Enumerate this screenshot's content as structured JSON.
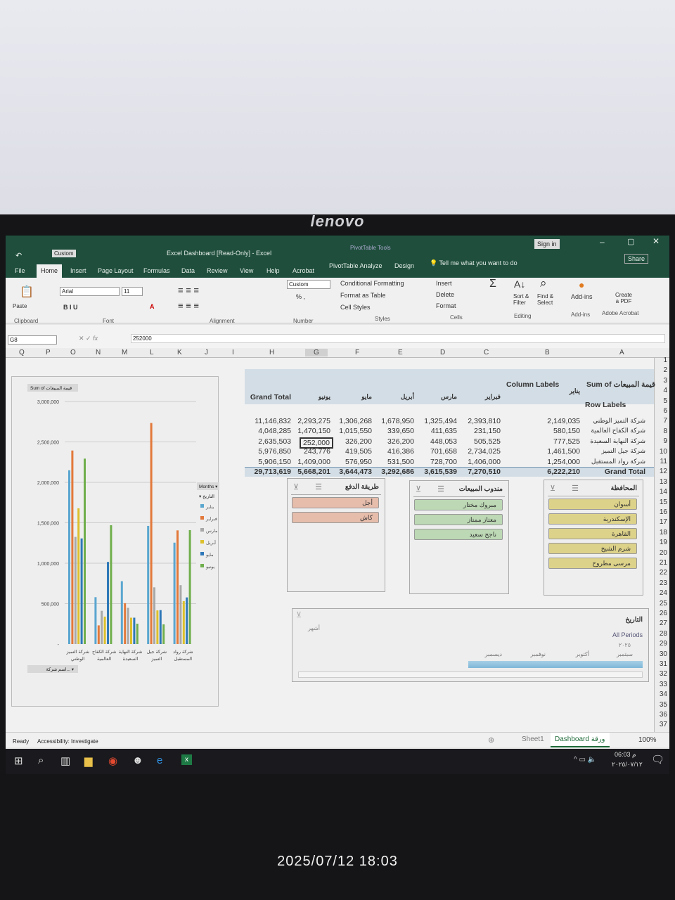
{
  "monitor": {
    "brand": "lenovo"
  },
  "photo_timestamp": "2025/07/12  18:03",
  "title": {
    "window": "Excel Dashboard  [Read-Only]  -  Excel",
    "contextual": "PivotTable Tools",
    "quick_style": "Custom",
    "sign_in": "Sign in",
    "share": "Share",
    "tell_me": "Tell me what you want to do"
  },
  "tabs": [
    "File",
    "Home",
    "Insert",
    "Page Layout",
    "Formulas",
    "Data",
    "Review",
    "View",
    "Help",
    "Acrobat",
    "PivotTable Analyze",
    "Design"
  ],
  "ribbon": {
    "paste": "Paste",
    "font_name": "Arial",
    "font_size": "11",
    "number_format": "Custom",
    "conditional": "Conditional Formatting",
    "format_table": "Format as Table",
    "cell_styles": "Cell Styles",
    "insert": "Insert",
    "delete": "Delete",
    "format": "Format",
    "sort": "Sort & Filter",
    "find": "Find & Select",
    "addins": "Add-ins",
    "create_pdf": "Create a PDF",
    "groups": {
      "clipboard": "Clipboard",
      "font": "Font",
      "alignment": "Alignment",
      "number": "Number",
      "styles": "Styles",
      "cells": "Cells",
      "editing": "Editing",
      "addins": "Add-ins",
      "acrobat": "Adobe Acrobat"
    }
  },
  "formula": {
    "name_box": "G8",
    "value": "252000"
  },
  "columns": [
    "A",
    "B",
    "C",
    "D",
    "E",
    "F",
    "G",
    "H",
    "I",
    "J",
    "K",
    "L",
    "M",
    "N",
    "O",
    "P",
    "Q"
  ],
  "pivot": {
    "corner": "Sum of قيمة المبيعات",
    "column_labels": "Column Labels",
    "row_labels": "Row Labels",
    "grand_total": "Grand Total",
    "months": [
      "يناير",
      "فبراير",
      "مارس",
      "أبريل",
      "مايو",
      "يونيو"
    ],
    "rows": [
      {
        "name": "شركة التميز الوطني",
        "values": [
          "2,149,035",
          "2,393,810",
          "1,325,494",
          "1,678,950",
          "1,306,268",
          "2,293,275",
          "11,146,832"
        ]
      },
      {
        "name": "شركة الكفاح العالمية",
        "values": [
          "580,150",
          "231,150",
          "411,635",
          "339,650",
          "1,015,550",
          "1,470,150",
          "4,048,285"
        ]
      },
      {
        "name": "شركة النهاية السعيدة",
        "values": [
          "777,525",
          "505,525",
          "448,053",
          "326,200",
          "326,200",
          "252,000",
          "2,635,503"
        ]
      },
      {
        "name": "شركة جيل التميز",
        "values": [
          "1,461,500",
          "2,734,025",
          "701,658",
          "416,386",
          "419,505",
          "243,776",
          "5,976,850"
        ]
      },
      {
        "name": "شركة رواد المستقبل",
        "values": [
          "1,254,000",
          "1,406,000",
          "728,700",
          "531,500",
          "576,950",
          "1,409,000",
          "5,906,150"
        ]
      }
    ],
    "totals": [
      "6,222,210",
      "7,270,510",
      "3,615,539",
      "3,292,686",
      "3,644,473",
      "5,668,201",
      "29,713,619"
    ]
  },
  "chart": {
    "value_button": "Sum of قيمة المبيعات",
    "axis_button": "اسم شركة...",
    "legend_button": "Months",
    "legend_sub": "التاريخ",
    "y_ticks": [
      "3,000,000",
      "2,500,000",
      "2,000,000",
      "1,500,000",
      "1,000,000",
      "500,000",
      "-"
    ],
    "y_max": 3000000,
    "categories": [
      "شركة التميز الوطني",
      "شركة الكفاح العالمية",
      "شركة النهاية السعيدة",
      "شركة جيل التميز",
      "شركة رواد المستقبل"
    ],
    "colors": [
      "#5aa6cf",
      "#e2793a",
      "#a8a8a8",
      "#dcc02c",
      "#2f78b8",
      "#6fae4c"
    ],
    "series": [
      [
        2149035,
        580150,
        777525,
        1461500,
        1254000
      ],
      [
        2393810,
        231150,
        505525,
        2734025,
        1406000
      ],
      [
        1325494,
        411635,
        448053,
        701658,
        728700
      ],
      [
        1678950,
        339650,
        326200,
        416386,
        531500
      ],
      [
        1306268,
        1015550,
        326200,
        419505,
        576950
      ],
      [
        2293275,
        1470150,
        252000,
        243776,
        1409000
      ]
    ]
  },
  "slicers": {
    "province": {
      "title": "المحافظة",
      "items": [
        "أسوان",
        "الإسكندرية",
        "القاهرة",
        "شرم الشيخ",
        "مرسى مطروح"
      ],
      "color": "#ddd28a"
    },
    "rep": {
      "title": "مندوب المبيعات",
      "items": [
        "مبروك مختار",
        "معتاز ممتاز",
        "ناجح سعيد"
      ],
      "color": "#bcd8b4"
    },
    "payment": {
      "title": "طريقة الدفع",
      "items": [
        "أجل",
        "كاش"
      ],
      "color": "#e6bcab"
    },
    "date": {
      "title": "التاريخ",
      "all": "All Periods",
      "year": "٢٠٢٥",
      "months": [
        "سبتمبر",
        "أكتوبر",
        "نوفمبر",
        "ديسمبر"
      ],
      "level": "أشهر"
    }
  },
  "status": {
    "ready": "Ready",
    "accessibility": "Accessibility: Investigate",
    "sheets": [
      "Sheet1",
      "Dashboard ورقة"
    ],
    "zoom": "100%"
  },
  "clock": {
    "time": "06:03 م",
    "date": "٢٠٢٥/٠٧/١٢"
  }
}
